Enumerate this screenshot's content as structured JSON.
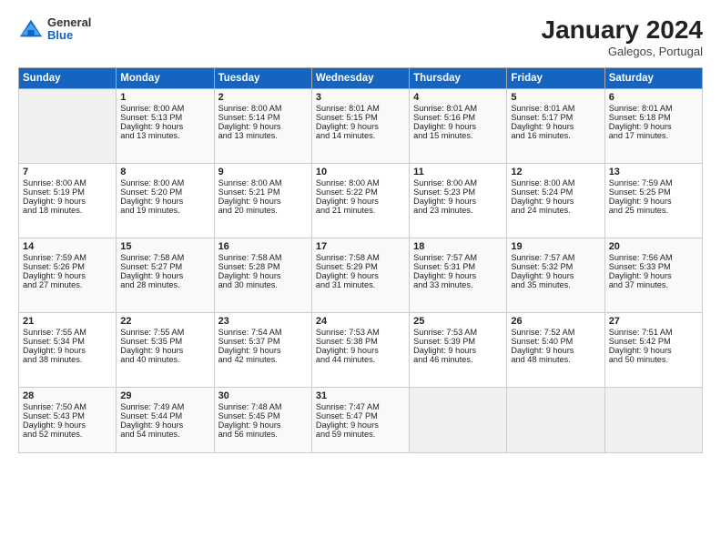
{
  "logo": {
    "general": "General",
    "blue": "Blue"
  },
  "header": {
    "month": "January 2024",
    "location": "Galegos, Portugal"
  },
  "days": [
    "Sunday",
    "Monday",
    "Tuesday",
    "Wednesday",
    "Thursday",
    "Friday",
    "Saturday"
  ],
  "weeks": [
    [
      {
        "day": "",
        "content": ""
      },
      {
        "day": "1",
        "content": "Sunrise: 8:00 AM\nSunset: 5:13 PM\nDaylight: 9 hours\nand 13 minutes."
      },
      {
        "day": "2",
        "content": "Sunrise: 8:00 AM\nSunset: 5:14 PM\nDaylight: 9 hours\nand 13 minutes."
      },
      {
        "day": "3",
        "content": "Sunrise: 8:01 AM\nSunset: 5:15 PM\nDaylight: 9 hours\nand 14 minutes."
      },
      {
        "day": "4",
        "content": "Sunrise: 8:01 AM\nSunset: 5:16 PM\nDaylight: 9 hours\nand 15 minutes."
      },
      {
        "day": "5",
        "content": "Sunrise: 8:01 AM\nSunset: 5:17 PM\nDaylight: 9 hours\nand 16 minutes."
      },
      {
        "day": "6",
        "content": "Sunrise: 8:01 AM\nSunset: 5:18 PM\nDaylight: 9 hours\nand 17 minutes."
      }
    ],
    [
      {
        "day": "7",
        "content": "Sunrise: 8:00 AM\nSunset: 5:19 PM\nDaylight: 9 hours\nand 18 minutes."
      },
      {
        "day": "8",
        "content": "Sunrise: 8:00 AM\nSunset: 5:20 PM\nDaylight: 9 hours\nand 19 minutes."
      },
      {
        "day": "9",
        "content": "Sunrise: 8:00 AM\nSunset: 5:21 PM\nDaylight: 9 hours\nand 20 minutes."
      },
      {
        "day": "10",
        "content": "Sunrise: 8:00 AM\nSunset: 5:22 PM\nDaylight: 9 hours\nand 21 minutes."
      },
      {
        "day": "11",
        "content": "Sunrise: 8:00 AM\nSunset: 5:23 PM\nDaylight: 9 hours\nand 23 minutes."
      },
      {
        "day": "12",
        "content": "Sunrise: 8:00 AM\nSunset: 5:24 PM\nDaylight: 9 hours\nand 24 minutes."
      },
      {
        "day": "13",
        "content": "Sunrise: 7:59 AM\nSunset: 5:25 PM\nDaylight: 9 hours\nand 25 minutes."
      }
    ],
    [
      {
        "day": "14",
        "content": "Sunrise: 7:59 AM\nSunset: 5:26 PM\nDaylight: 9 hours\nand 27 minutes."
      },
      {
        "day": "15",
        "content": "Sunrise: 7:58 AM\nSunset: 5:27 PM\nDaylight: 9 hours\nand 28 minutes."
      },
      {
        "day": "16",
        "content": "Sunrise: 7:58 AM\nSunset: 5:28 PM\nDaylight: 9 hours\nand 30 minutes."
      },
      {
        "day": "17",
        "content": "Sunrise: 7:58 AM\nSunset: 5:29 PM\nDaylight: 9 hours\nand 31 minutes."
      },
      {
        "day": "18",
        "content": "Sunrise: 7:57 AM\nSunset: 5:31 PM\nDaylight: 9 hours\nand 33 minutes."
      },
      {
        "day": "19",
        "content": "Sunrise: 7:57 AM\nSunset: 5:32 PM\nDaylight: 9 hours\nand 35 minutes."
      },
      {
        "day": "20",
        "content": "Sunrise: 7:56 AM\nSunset: 5:33 PM\nDaylight: 9 hours\nand 37 minutes."
      }
    ],
    [
      {
        "day": "21",
        "content": "Sunrise: 7:55 AM\nSunset: 5:34 PM\nDaylight: 9 hours\nand 38 minutes."
      },
      {
        "day": "22",
        "content": "Sunrise: 7:55 AM\nSunset: 5:35 PM\nDaylight: 9 hours\nand 40 minutes."
      },
      {
        "day": "23",
        "content": "Sunrise: 7:54 AM\nSunset: 5:37 PM\nDaylight: 9 hours\nand 42 minutes."
      },
      {
        "day": "24",
        "content": "Sunrise: 7:53 AM\nSunset: 5:38 PM\nDaylight: 9 hours\nand 44 minutes."
      },
      {
        "day": "25",
        "content": "Sunrise: 7:53 AM\nSunset: 5:39 PM\nDaylight: 9 hours\nand 46 minutes."
      },
      {
        "day": "26",
        "content": "Sunrise: 7:52 AM\nSunset: 5:40 PM\nDaylight: 9 hours\nand 48 minutes."
      },
      {
        "day": "27",
        "content": "Sunrise: 7:51 AM\nSunset: 5:42 PM\nDaylight: 9 hours\nand 50 minutes."
      }
    ],
    [
      {
        "day": "28",
        "content": "Sunrise: 7:50 AM\nSunset: 5:43 PM\nDaylight: 9 hours\nand 52 minutes."
      },
      {
        "day": "29",
        "content": "Sunrise: 7:49 AM\nSunset: 5:44 PM\nDaylight: 9 hours\nand 54 minutes."
      },
      {
        "day": "30",
        "content": "Sunrise: 7:48 AM\nSunset: 5:45 PM\nDaylight: 9 hours\nand 56 minutes."
      },
      {
        "day": "31",
        "content": "Sunrise: 7:47 AM\nSunset: 5:47 PM\nDaylight: 9 hours\nand 59 minutes."
      },
      {
        "day": "",
        "content": ""
      },
      {
        "day": "",
        "content": ""
      },
      {
        "day": "",
        "content": ""
      }
    ]
  ]
}
